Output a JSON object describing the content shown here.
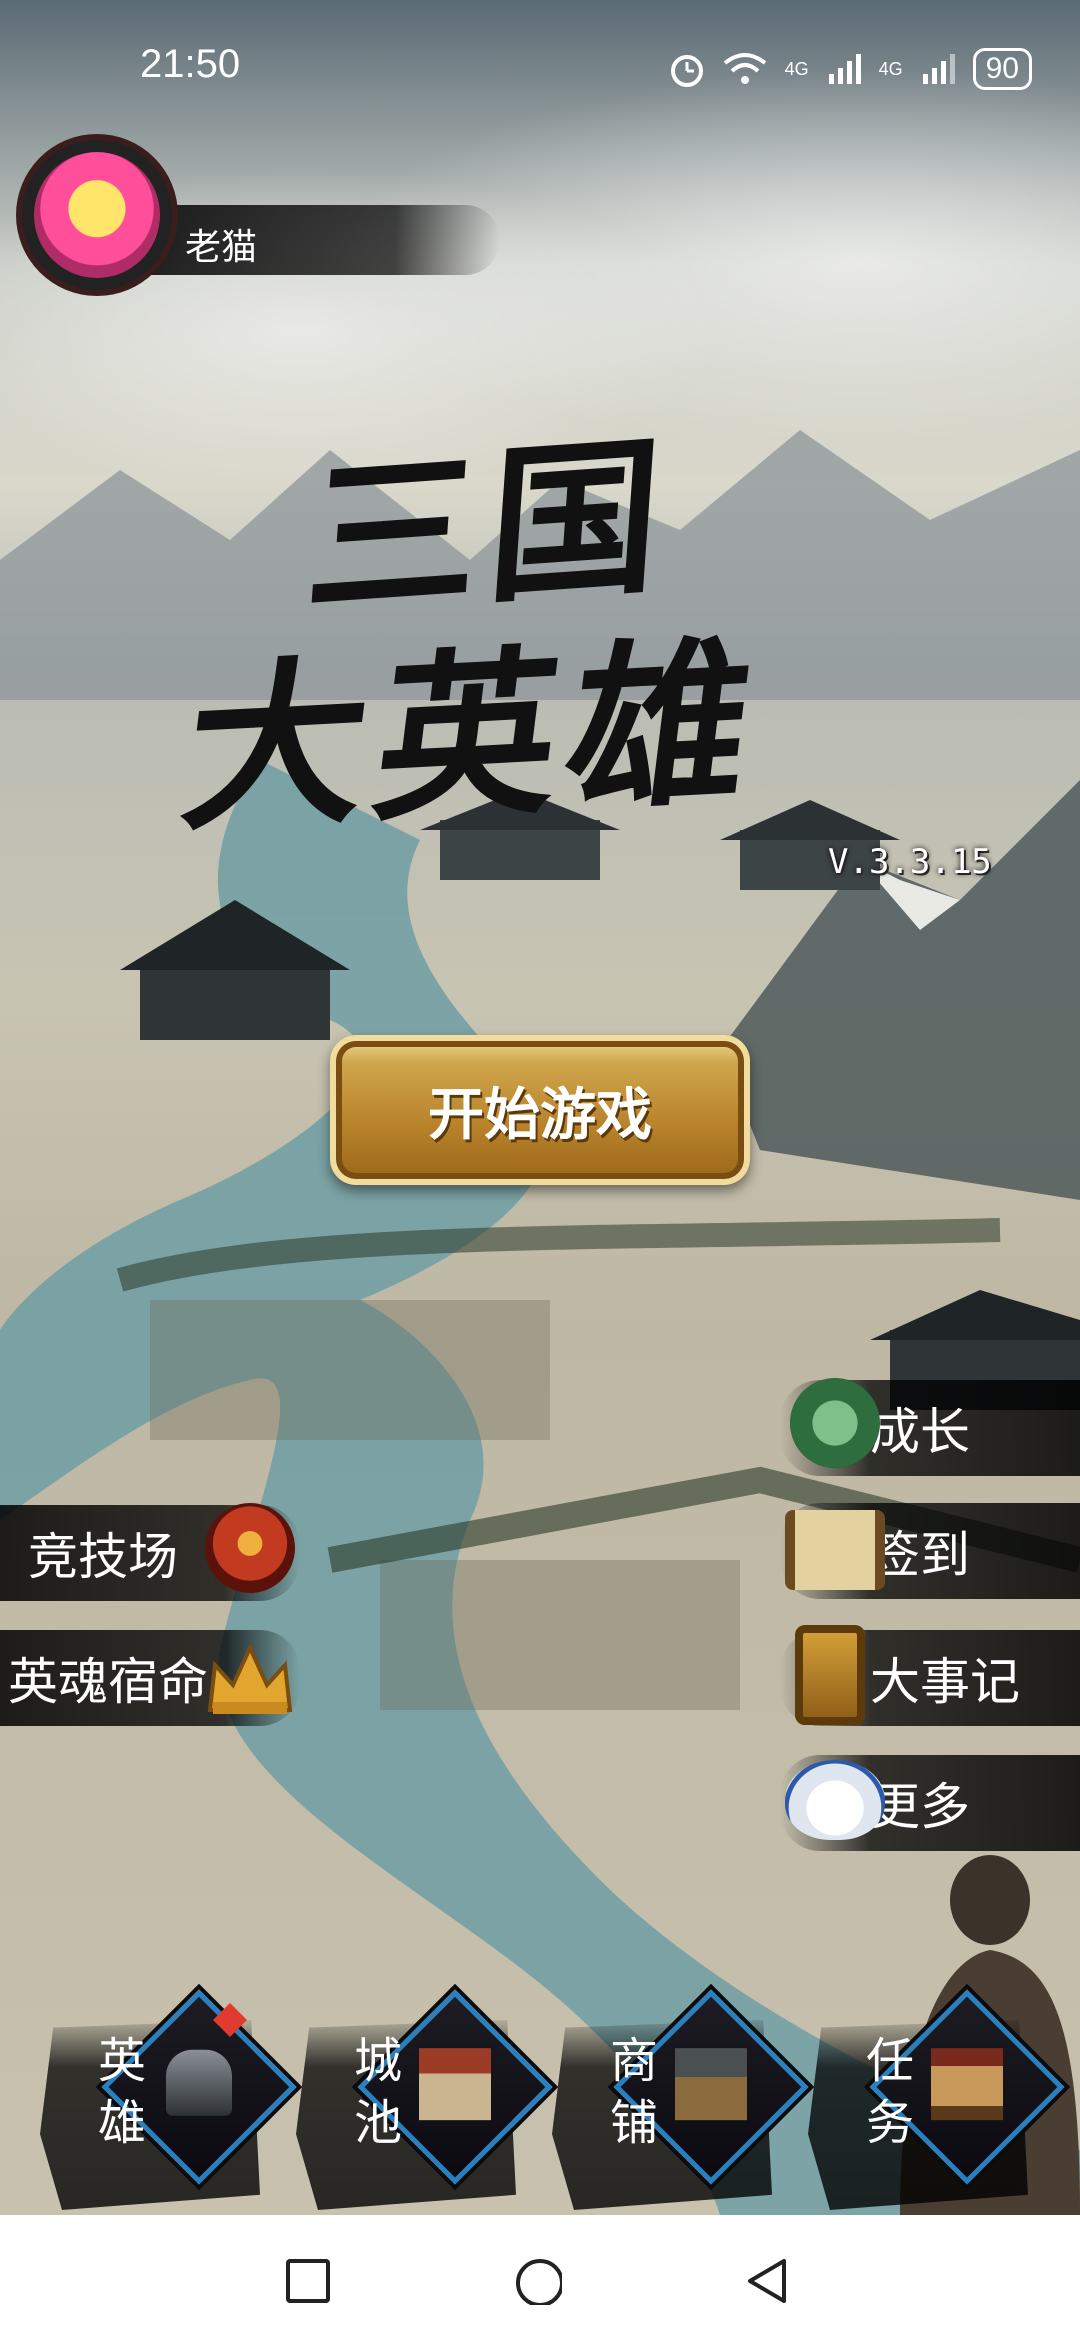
{
  "status_bar": {
    "time": "21:50",
    "network_labels": [
      "4G",
      "4G"
    ],
    "battery": "90"
  },
  "profile": {
    "player_name": "老猫"
  },
  "game": {
    "title_line1": "三国",
    "title_line2": "大英雄",
    "version": "V.3.3.15",
    "start_button_label": "开始游戏"
  },
  "right_menu": [
    {
      "label": "成长",
      "icon": "jade-disc-icon"
    },
    {
      "label": "签到",
      "icon": "scroll-icon"
    },
    {
      "label": "大事记",
      "icon": "lantern-icon"
    },
    {
      "label": "更多",
      "icon": "tea-bowl-icon"
    }
  ],
  "left_menu": [
    {
      "label": "竞技场",
      "icon": "dragon-icon"
    },
    {
      "label": "英魂宿命",
      "icon": "crown-icon"
    }
  ],
  "bottom_nav": [
    {
      "label": "英雄",
      "icon": "helmet-icon",
      "has_badge": true
    },
    {
      "label": "城池",
      "icon": "city-gate-icon",
      "has_badge": false
    },
    {
      "label": "商铺",
      "icon": "shop-icon",
      "has_badge": false
    },
    {
      "label": "任务",
      "icon": "notice-board-icon",
      "has_badge": false
    }
  ],
  "colors": {
    "start_button_gold": "#b8832b",
    "nav_diamond_border": "#2a7fbf",
    "badge_red": "#e13a2f"
  }
}
